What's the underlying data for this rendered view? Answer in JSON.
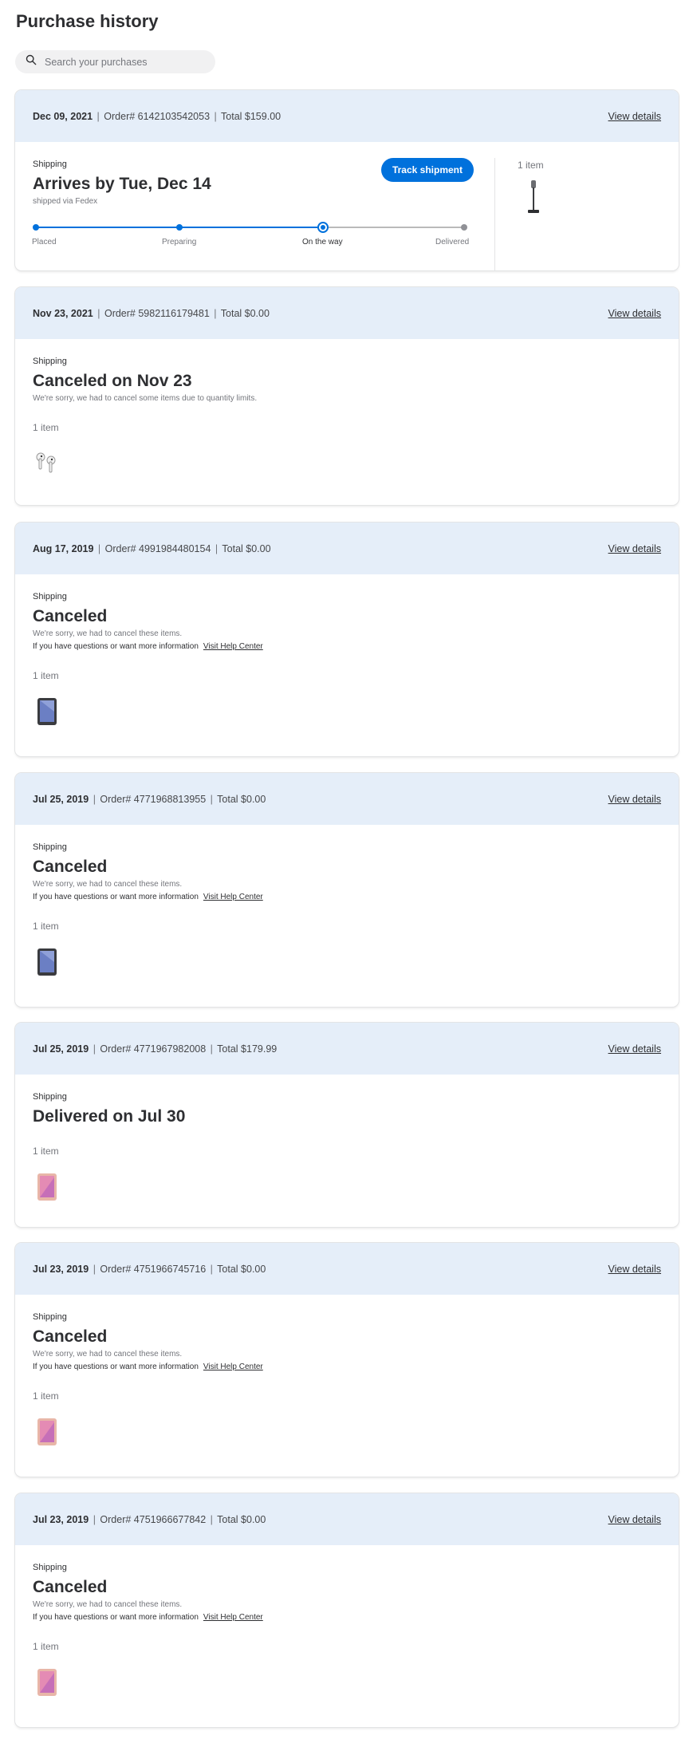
{
  "page": {
    "title": "Purchase history"
  },
  "search": {
    "placeholder": "Search your purchases"
  },
  "view_details_label": "View details",
  "shipping_label": "Shipping",
  "items_label": "1 item",
  "help_text": "If you have questions or want more information",
  "help_link": "Visit Help Center",
  "orders": [
    {
      "date": "Dec 09, 2021",
      "order": "Order# 6142103542053",
      "total": "Total $159.00",
      "status": "Arrives by Tue, Dec 14",
      "note": "shipped via Fedex",
      "track_label": "Track shipment",
      "progress_steps": [
        "Placed",
        "Preparing",
        "On the way",
        "Delivered"
      ],
      "current_step": "On the way",
      "item_icon": "stick-vacuum-icon"
    },
    {
      "date": "Nov 23, 2021",
      "order": "Order# 5982116179481",
      "total": "Total $0.00",
      "status": "Canceled on Nov 23",
      "note": "We're sorry, we had to cancel some items due to quantity limits.",
      "item_icon": "earbuds-icon"
    },
    {
      "date": "Aug 17, 2019",
      "order": "Order# 4991984480154",
      "total": "Total $0.00",
      "status": "Canceled",
      "note": "We're sorry, we had to cancel these items.",
      "item_icon": "tablet-gray-icon"
    },
    {
      "date": "Jul 25, 2019",
      "order": "Order# 4771968813955",
      "total": "Total $0.00",
      "status": "Canceled",
      "note": "We're sorry, we had to cancel these items.",
      "item_icon": "tablet-gray-icon"
    },
    {
      "date": "Jul 25, 2019",
      "order": "Order# 4771967982008",
      "total": "Total $179.99",
      "status": "Delivered on Jul 30",
      "item_icon": "tablet-rose-icon"
    },
    {
      "date": "Jul 23, 2019",
      "order": "Order# 4751966745716",
      "total": "Total $0.00",
      "status": "Canceled",
      "note": "We're sorry, we had to cancel these items.",
      "item_icon": "tablet-rose-icon"
    },
    {
      "date": "Jul 23, 2019",
      "order": "Order# 4751966677842",
      "total": "Total $0.00",
      "status": "Canceled",
      "note": "We're sorry, we had to cancel these items.",
      "item_icon": "tablet-rose-icon"
    }
  ],
  "colors": {
    "accent": "#0071dc",
    "header_bg": "#e5eef9",
    "muted": "#74767c"
  }
}
